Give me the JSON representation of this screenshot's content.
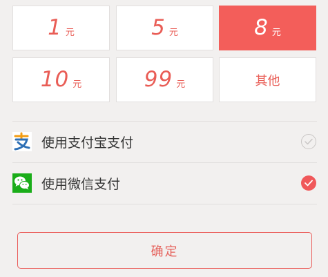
{
  "amounts": [
    {
      "value": "1",
      "unit": "元",
      "selected": false
    },
    {
      "value": "5",
      "unit": "元",
      "selected": false
    },
    {
      "value": "8",
      "unit": "元",
      "selected": true
    },
    {
      "value": "10",
      "unit": "元",
      "selected": false
    },
    {
      "value": "99",
      "unit": "元",
      "selected": false
    },
    {
      "label": "其他",
      "selected": false
    }
  ],
  "payment_methods": [
    {
      "label": "使用支付宝支付",
      "icon": "alipay-icon",
      "selected": false
    },
    {
      "label": "使用微信支付",
      "icon": "wechat-icon",
      "selected": true
    }
  ],
  "confirm_label": "确定",
  "colors": {
    "accent": "#f35e5a",
    "text_accent": "#e95d56",
    "background": "#f2f0ef",
    "alipay_orange": "#f39c12",
    "alipay_blue": "#2d6fb5",
    "wechat_green": "#1aad19"
  }
}
